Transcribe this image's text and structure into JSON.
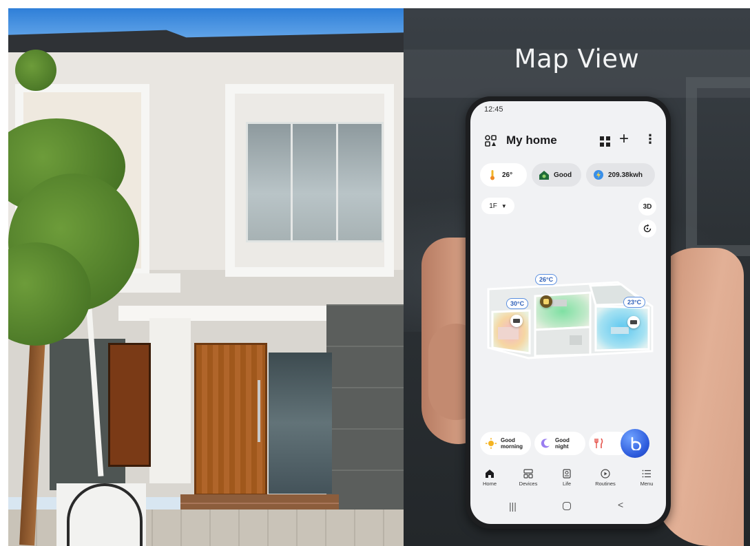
{
  "headline": "Map View",
  "phone": {
    "status_time": "12:45",
    "header": {
      "title": "My home",
      "icons": [
        "home-layout-icon",
        "grid-view-icon",
        "plus-icon",
        "more-vertical-icon"
      ]
    },
    "chips": [
      {
        "icon": "thermometer-icon",
        "label": "26°"
      },
      {
        "icon": "air-quality-icon",
        "label": "Good"
      },
      {
        "icon": "energy-icon",
        "label": "209.38kwh"
      }
    ],
    "floor_selector": {
      "value": "1F",
      "icon": "caret-down-icon"
    },
    "view_3d_label": "3D",
    "map": {
      "room_bubbles": [
        {
          "label": "30°C"
        },
        {
          "label": "26°C"
        },
        {
          "label": "23°C"
        }
      ]
    },
    "scenes": [
      {
        "icon": "sun-icon",
        "line1": "Good",
        "line2": "morning"
      },
      {
        "icon": "moon-icon",
        "line1": "Good",
        "line2": "night"
      },
      {
        "icon": "fork-knife-icon",
        "line1": "",
        "line2": ""
      }
    ],
    "nav": [
      {
        "icon": "home-icon",
        "label": "Home"
      },
      {
        "icon": "devices-icon",
        "label": "Devices"
      },
      {
        "icon": "life-icon",
        "label": "Life"
      },
      {
        "icon": "routines-icon",
        "label": "Routines"
      },
      {
        "icon": "menu-icon",
        "label": "Menu"
      }
    ],
    "system_nav": {
      "recent": "|||",
      "back": "<"
    }
  },
  "colors": {
    "accent_blue": "#2d5bdc",
    "bubble_border": "#5a8fe0",
    "screen_bg": "#f1f2f4",
    "backdrop": "#2c3135"
  }
}
